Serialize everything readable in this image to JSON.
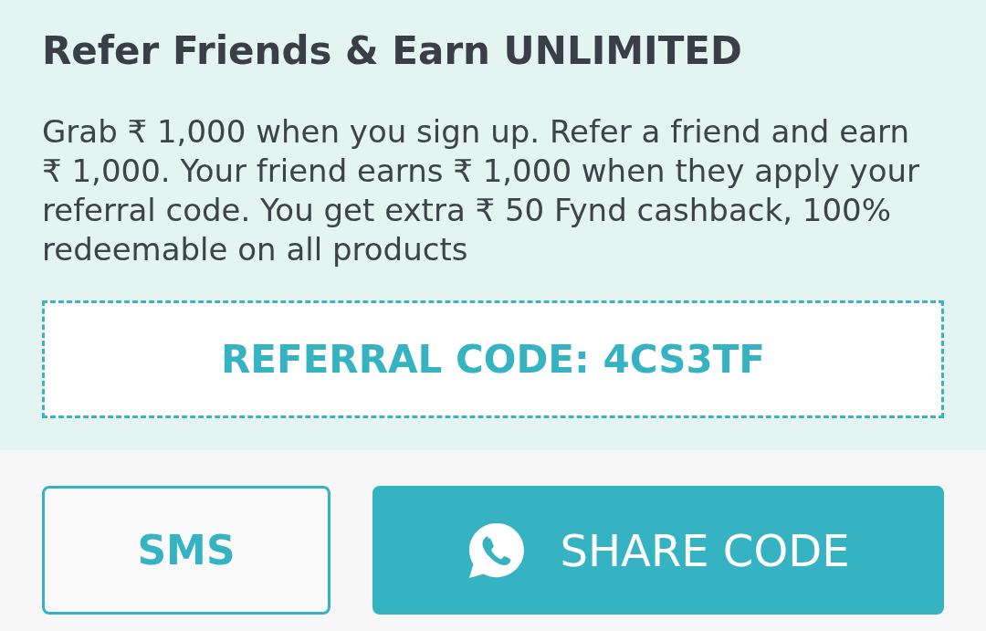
{
  "header": {
    "title": "Refer Friends & Earn UNLIMITED",
    "description": "Grab ₹ 1,000 when you sign up. Refer a friend and earn ₹ 1,000. Your friend earns ₹ 1,000 when they apply your referral code. You get extra ₹ 50 Fynd cashback, 100% redeemable on all products"
  },
  "referral_code": {
    "text": "REFERRAL CODE: 4CS3TF"
  },
  "buttons": [
    {
      "label": "SMS",
      "kind": "outline"
    },
    {
      "label": "SHARE CODE",
      "kind": "primary"
    }
  ]
}
